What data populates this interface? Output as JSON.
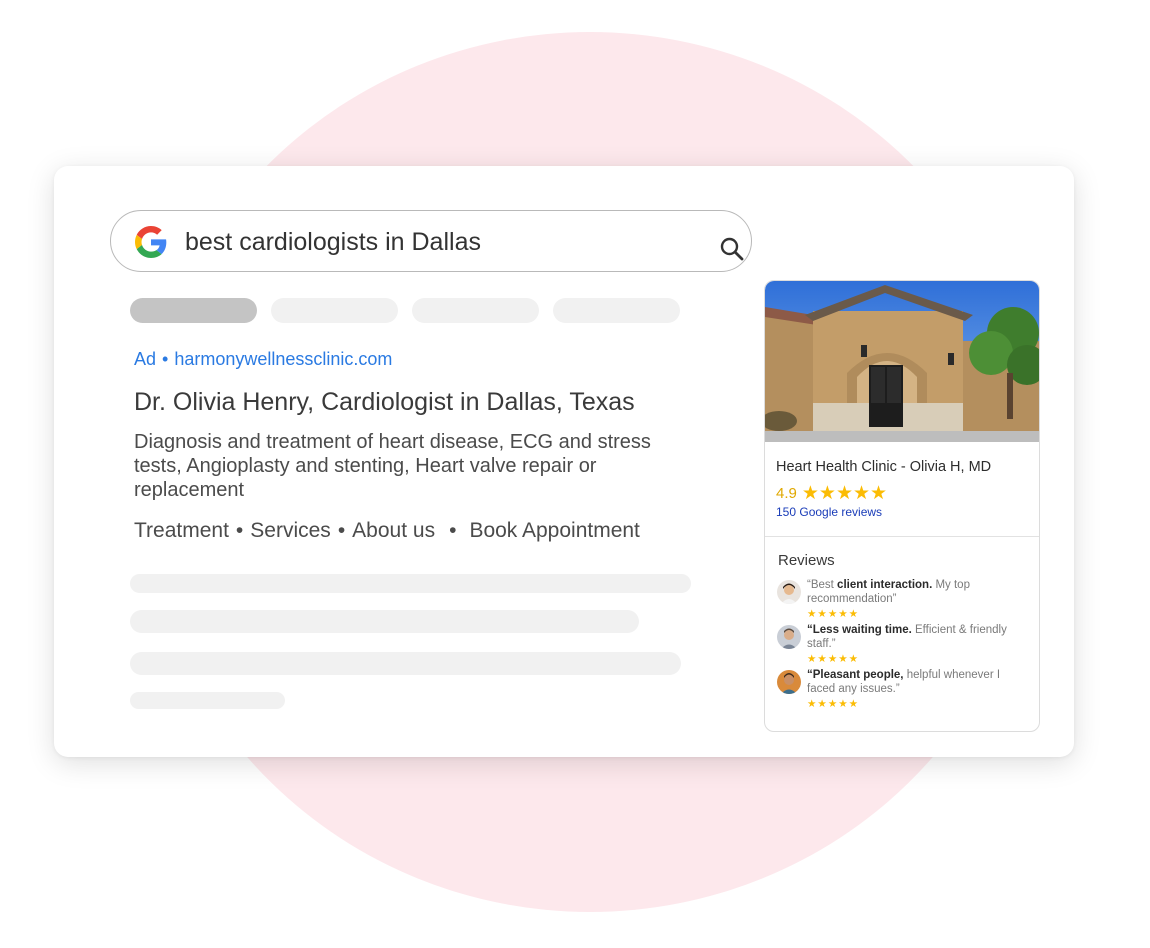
{
  "search": {
    "query": "best cardiologists in Dallas"
  },
  "ad": {
    "label": "Ad",
    "separator": "•",
    "url": "harmonywellnessclinic.com",
    "title": "Dr. Olivia Henry, Cardiologist in Dallas, Texas",
    "description": "Diagnosis and treatment of heart disease, ECG and stress tests, Angioplasty and stenting, Heart valve repair or replacement",
    "sitelinks": [
      "Treatment",
      "Services",
      "About us",
      "Book Appointment"
    ],
    "sitelink_separator": "•"
  },
  "panel": {
    "name": "Heart Health Clinic - Olivia H, MD",
    "rating": "4.9",
    "rating_value": 5,
    "review_count": "150 Google reviews",
    "reviews_title": "Reviews",
    "reviews": [
      {
        "bold": "client interaction.",
        "pre": "“Best ",
        "post": " My top recommendation”",
        "stars": 5
      },
      {
        "bold": "“Less waiting time.",
        "pre": "",
        "post": " Efficient & friendly staff.”",
        "stars": 5
      },
      {
        "bold": "“Pleasant people,",
        "pre": "",
        "post": " helpful whenever I faced any issues.”",
        "stars": 5
      }
    ]
  },
  "colors": {
    "accent_link": "#2a7ae2",
    "star": "#fbbc04",
    "background_circle": "#fde8ec"
  },
  "icons": {
    "logo": "google-logo-icon",
    "search": "magnifier-icon",
    "star": "star-icon"
  }
}
